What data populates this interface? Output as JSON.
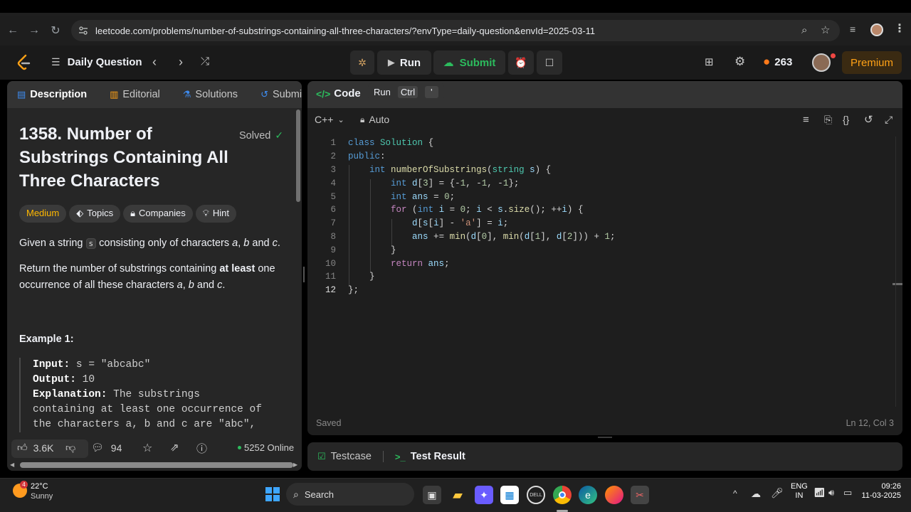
{
  "browser": {
    "url": "leetcode.com/problems/number-of-substrings-containing-all-three-characters/?envType=daily-question&envId=2025-03-11"
  },
  "nav": {
    "title": "Daily Question",
    "run_label": "Run",
    "submit_label": "Submit",
    "streak": "263",
    "premium_label": "Premium",
    "tooltip_run": "Run",
    "tooltip_key": "Ctrl",
    "tooltip_key2": "'"
  },
  "left": {
    "tabs": [
      "Description",
      "Editorial",
      "Solutions",
      "Submissi"
    ],
    "title": "1358. Number of Substrings Containing All Three Characters",
    "solved_label": "Solved",
    "tags": [
      "Medium",
      "Topics",
      "Companies",
      "Hint"
    ],
    "p1_pre": "Given a string",
    "p1_code": "s",
    "p1_post": "consisting only of characters",
    "p1_a": "a",
    "p1_sep1": ",",
    "p1_b": "b",
    "p1_and": "and",
    "p1_c": "c",
    "p1_end": ".",
    "p2_pre": "Return the number of substrings containing",
    "p2_bold": "at least",
    "p2_post": "one occurrence of all these characters",
    "p2_a": "a",
    "p2_sep": ",",
    "p2_b": "b",
    "p2_and": "and",
    "p2_c": "c",
    "p2_end": ".",
    "example_title": "Example 1:",
    "ex_input_label": "Input:",
    "ex_input": "s = \"abcabc\"",
    "ex_output_label": "Output:",
    "ex_output": "10",
    "ex_expl_label": "Explanation:",
    "ex_expl1": "The substrings",
    "ex_expl2": "containing at least one occurrence of",
    "ex_expl3": "the characters a, b and c are \"abc\",",
    "likes": "3.6K",
    "comments": "94",
    "online": "5252 Online"
  },
  "code": {
    "tab_label": "Code",
    "language": "C++",
    "mode": "Auto",
    "lines": [
      "class Solution {",
      "public:",
      "    int numberOfSubstrings(string s) {",
      "        int d[3] = {-1, -1, -1};",
      "        int ans = 0;",
      "        for (int i = 0; i < s.size(); ++i) {",
      "            d[s[i] - 'a'] = i;",
      "            ans += min(d[0], min(d[1], d[2])) + 1;",
      "        }",
      "        return ans;",
      "    }",
      "};"
    ],
    "line_numbers": [
      "1",
      "2",
      "3",
      "4",
      "5",
      "6",
      "7",
      "8",
      "9",
      "10",
      "11",
      "12"
    ],
    "saved": "Saved",
    "cursor": "Ln 12, Col 3"
  },
  "test": {
    "testcase_label": "Testcase",
    "result_label": "Test Result"
  },
  "taskbar": {
    "temp": "22°C",
    "weather": "Sunny",
    "badge": "4",
    "search": "Search",
    "lang1": "ENG",
    "lang2": "IN",
    "time": "09:26",
    "date": "11-03-2025"
  },
  "colors": {
    "accent_green": "#2cbb5d",
    "medium": "#ffb800",
    "premium": "#ffa116",
    "streak": "#ff7a1a"
  }
}
